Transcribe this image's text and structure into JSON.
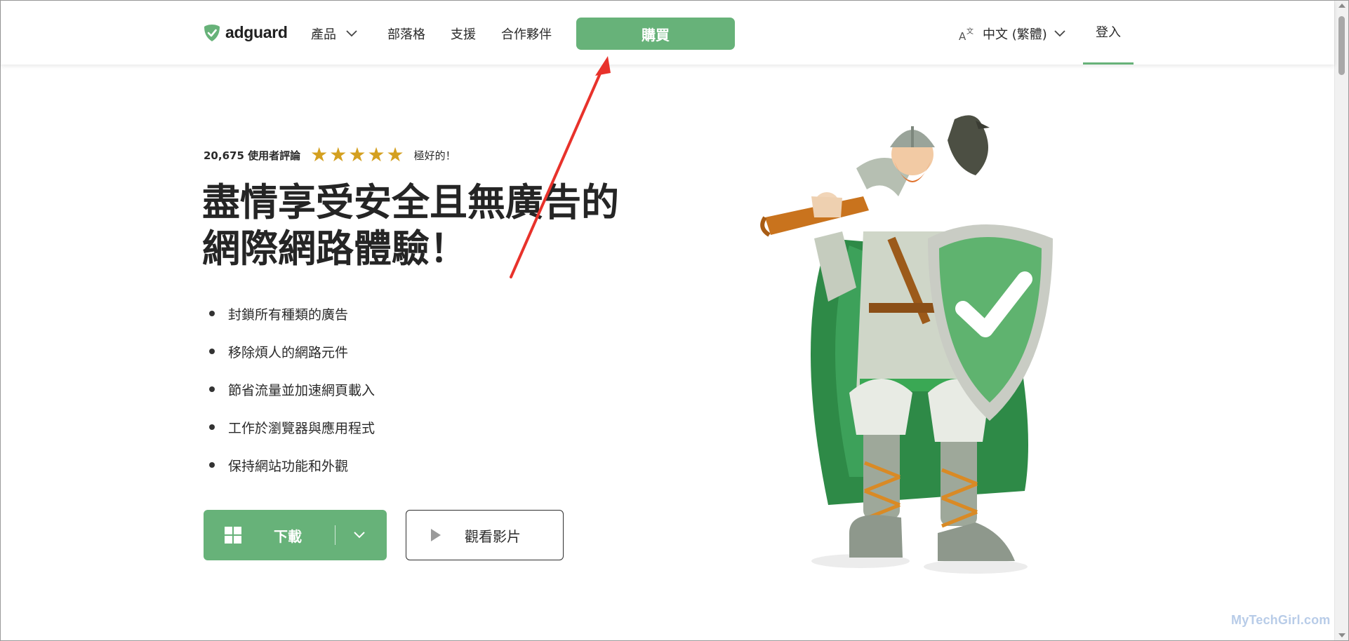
{
  "header": {
    "logo_text": "adguard",
    "nav": [
      {
        "label": "產品",
        "has_dropdown": true
      },
      {
        "label": "部落格"
      },
      {
        "label": "支援"
      },
      {
        "label": "合作夥伴"
      }
    ],
    "buy_label": "購買",
    "language_label": "中文 (繁體)",
    "login_label": "登入"
  },
  "hero": {
    "rating_count": "20,675 使用者評論",
    "rating_stars": 5,
    "rating_label": "極好的！",
    "title_lines": [
      "盡情享受安全且無廣告的",
      "網際網路體驗！"
    ],
    "features": [
      "封鎖所有種類的廣告",
      "移除煩人的網路元件",
      "節省流量並加速網頁載入",
      "工作於瀏覽器與應用程式",
      "保持網站功能和外觀"
    ],
    "download_label": "下載",
    "video_label": "觀看影片"
  },
  "watermark": "MyTechGirl.com",
  "colors": {
    "brand_green": "#67b279",
    "star_gold": "#d4a020",
    "annotation_red": "#e8322b",
    "shield_green": "#5fb36f"
  },
  "icons": [
    "shield-logo-icon",
    "chevron-down-icon",
    "translate-icon",
    "star-icon",
    "windows-icon",
    "play-icon",
    "red-arrow-annotation"
  ]
}
